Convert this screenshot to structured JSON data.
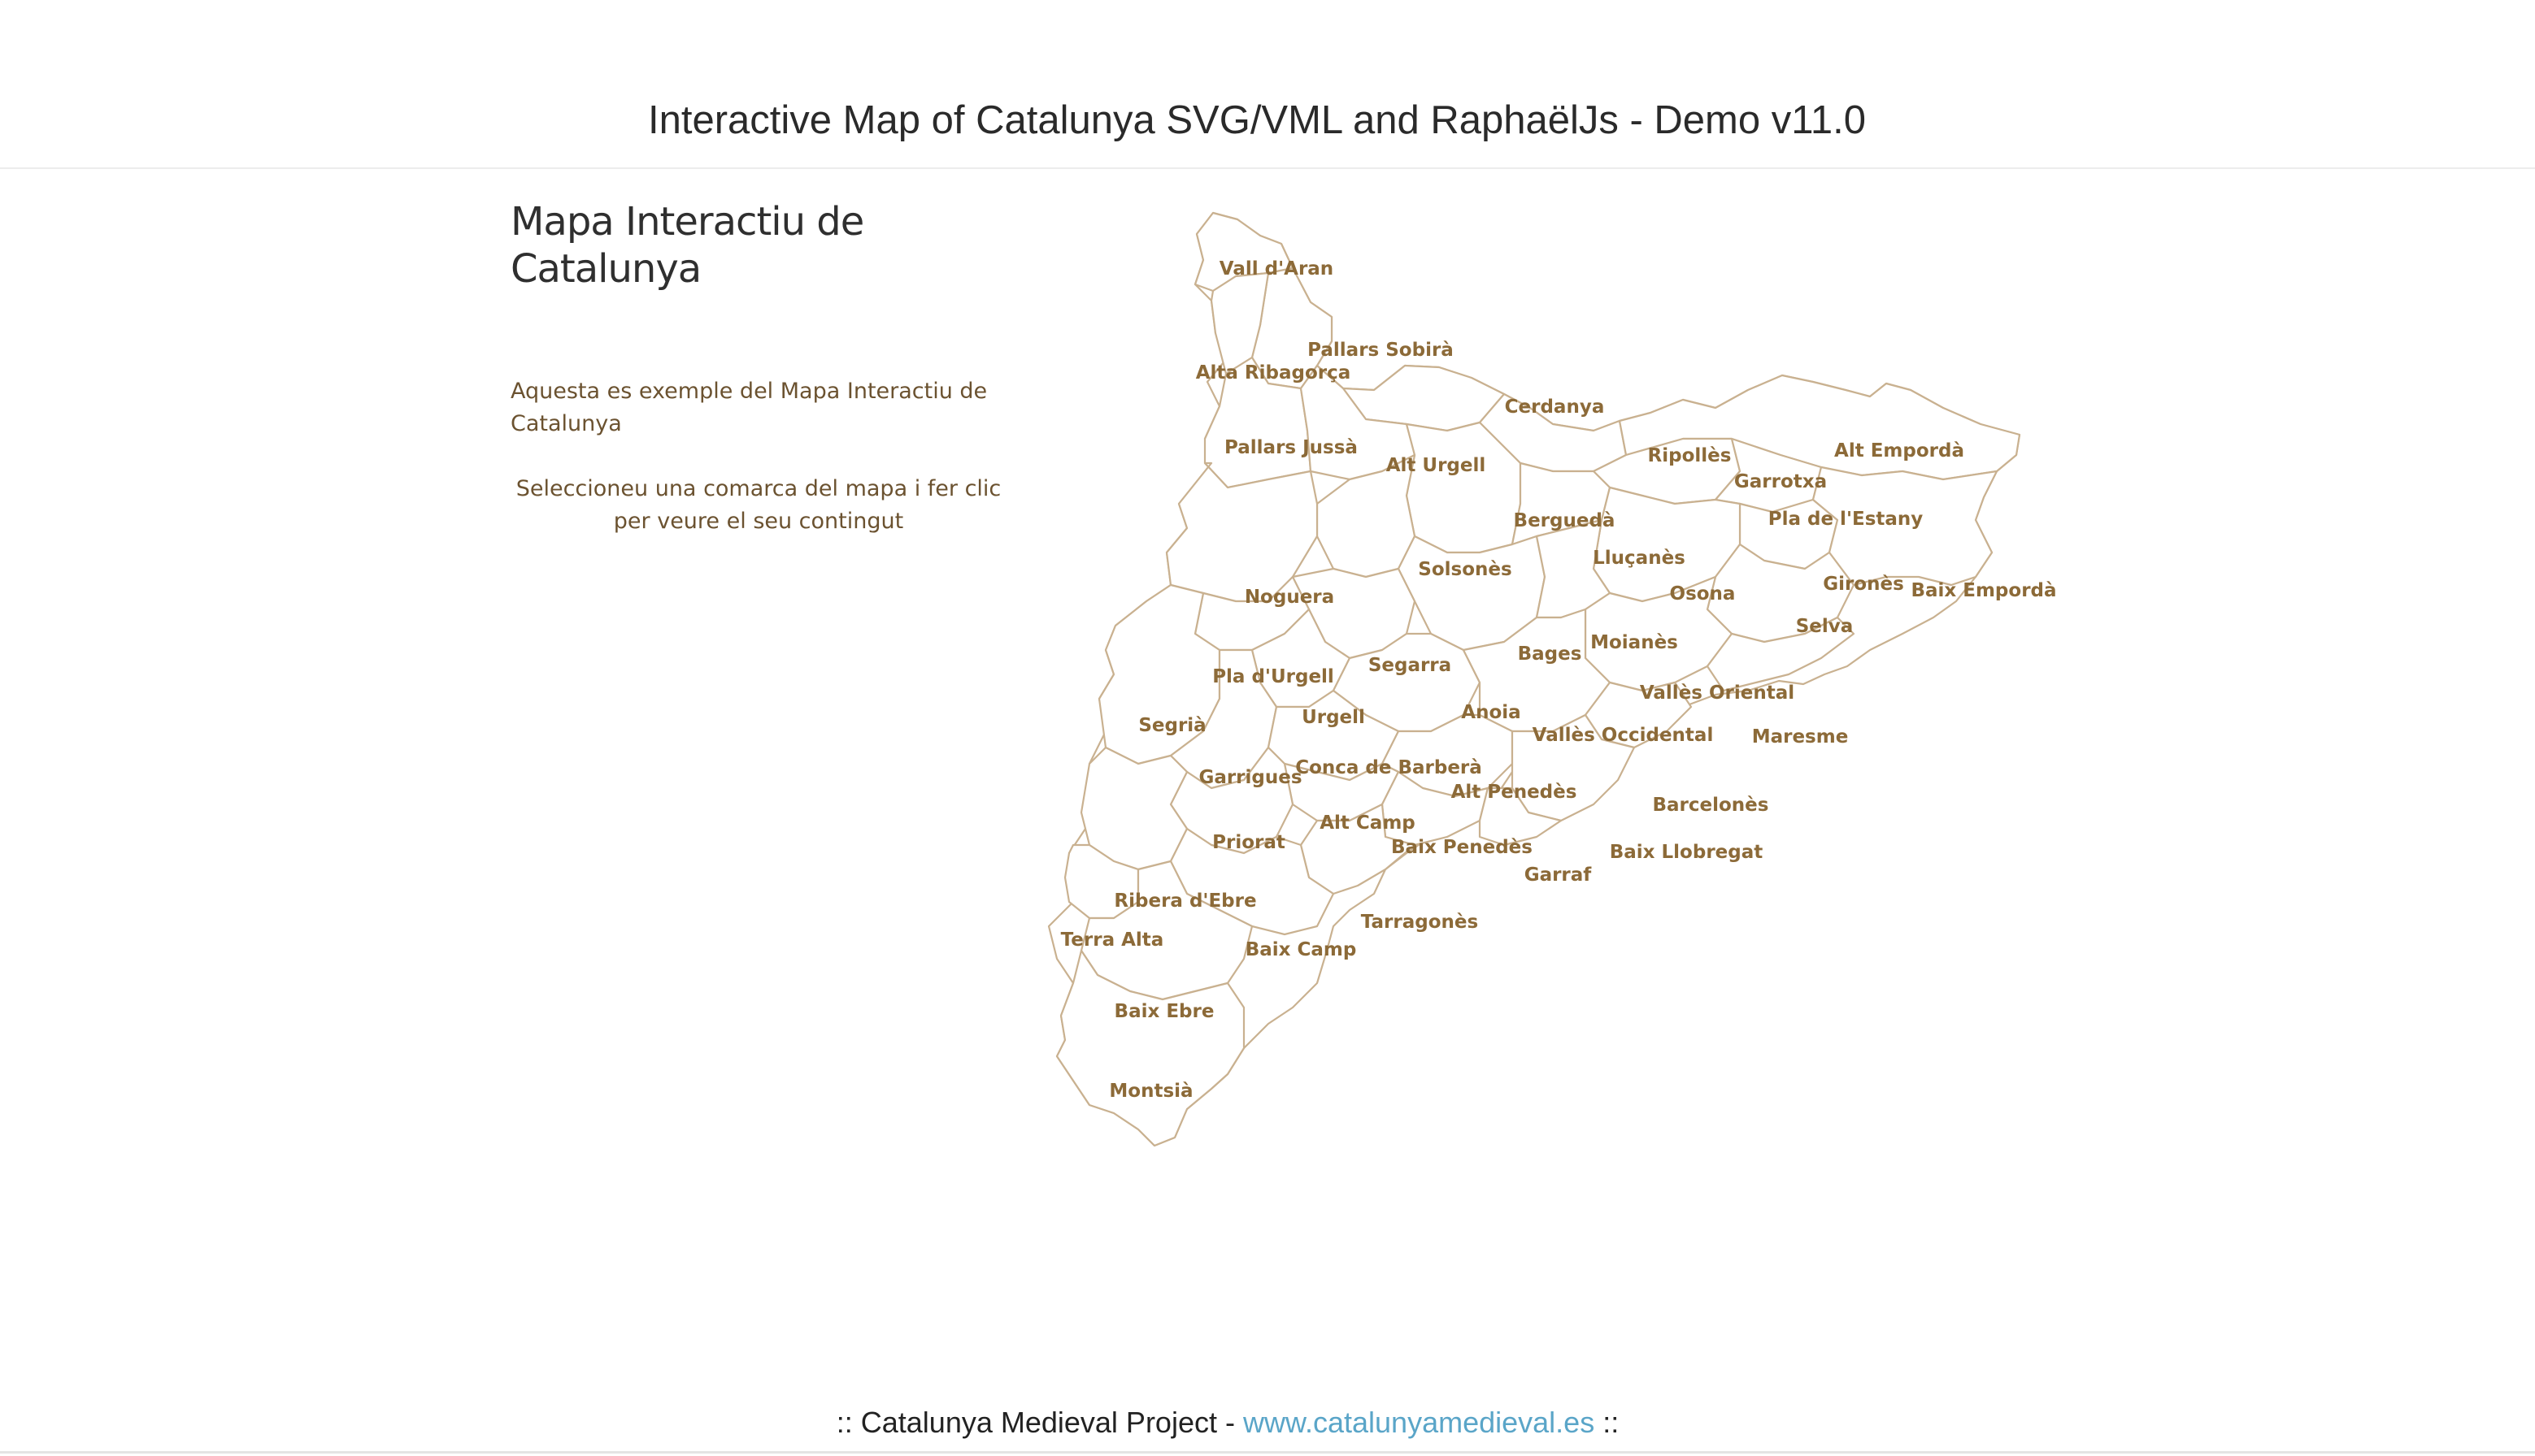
{
  "header": {
    "title": "Interactive Map of Catalunya SVG/VML and RaphaëlJs - Demo v11.0"
  },
  "sidebar": {
    "title": "Mapa Interactiu de Catalunya",
    "intro": "Aquesta es exemple del Mapa Interactiu de Catalunya",
    "instructions": "Seleccioneu una comarca del mapa i fer clic per veure el seu contingut"
  },
  "map": {
    "comarques": [
      "Vall d'Aran",
      "Pallars Sobirà",
      "Alta Ribagorça",
      "Cerdanya",
      "Pallars Jussà",
      "Alt Urgell",
      "Ripollès",
      "Alt Empordà",
      "Garrotxa",
      "Berguedà",
      "Pla de l'Estany",
      "Solsonès",
      "Lluçanès",
      "Gironès",
      "Baix Empordà",
      "Noguera",
      "Osona",
      "Selva",
      "Moianès",
      "Bages",
      "Segarra",
      "Pla d'Urgell",
      "Vallès Oriental",
      "Anoia",
      "Urgell",
      "Segrià",
      "Vallès Occidental",
      "Maresme",
      "Conca de Barberà",
      "Garrigues",
      "Alt Penedès",
      "Barcelonès",
      "Alt Camp",
      "Priorat",
      "Baix Penedès",
      "Baix Llobregat",
      "Garraf",
      "Ribera d'Ebre",
      "Tarragonès",
      "Terra Alta",
      "Baix Camp",
      "Baix Ebre",
      "Montsià"
    ]
  },
  "footer": {
    "prefix": ":: Catalunya Medieval Project -",
    "link_text": "www.catalunyamedieval.es",
    "suffix": "::"
  },
  "colors": {
    "map_stroke": "#c9b190",
    "map_label": "#8c6a38",
    "sidebar_text": "#6b5230",
    "footer_link": "#5aa5c8"
  }
}
